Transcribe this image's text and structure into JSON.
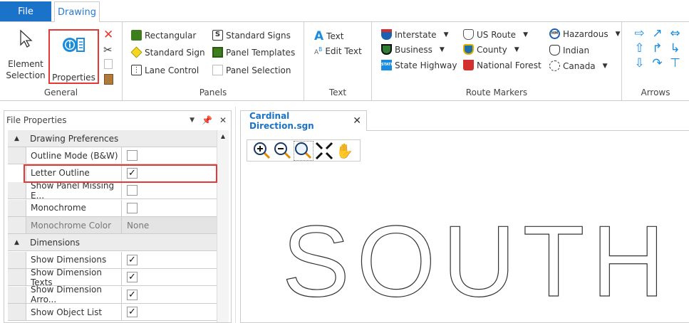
{
  "tabs": {
    "file": "File",
    "drawing": "Drawing"
  },
  "general": {
    "label": "General",
    "element_selection": "Element Selection",
    "properties": "Properties"
  },
  "panels": {
    "label": "Panels",
    "items": [
      "Rectangular",
      "Standard Sign",
      "Lane Control",
      "Standard Signs",
      "Panel Templates",
      "Panel Selection"
    ]
  },
  "text": {
    "label": "Text",
    "text": "Text",
    "edit_text": "Edit Text"
  },
  "route_markers": {
    "label": "Route Markers",
    "items": [
      "Interstate",
      "Business",
      "State Highway",
      "US Route",
      "County",
      "National Forest",
      "Hazardous",
      "Indian",
      "Canada"
    ],
    "state_badge": "STATE",
    "hm_badge": "HM"
  },
  "arrows": {
    "label": "Arrows"
  },
  "file_properties": {
    "title": "File Properties",
    "categories": [
      {
        "name": "Drawing Preferences",
        "rows": [
          {
            "label": "Outline Mode (B&W)",
            "checked": false
          },
          {
            "label": "Letter Outline",
            "checked": true
          },
          {
            "label": "Show Panel Missing E...",
            "checked": false
          },
          {
            "label": "Monochrome",
            "checked": false
          },
          {
            "label": "Monochrome Color",
            "value": "None",
            "disabled": true
          }
        ]
      },
      {
        "name": "Dimensions",
        "rows": [
          {
            "label": "Show Dimensions",
            "checked": true
          },
          {
            "label": "Show Dimension Texts",
            "checked": true
          },
          {
            "label": "Show Dimension Arro...",
            "checked": true
          },
          {
            "label": "Show Object List",
            "checked": true
          }
        ]
      }
    ]
  },
  "document": {
    "tab": "Cardinal Direction.sgn",
    "canvas_text": "SOUTH"
  },
  "colors": {
    "accent": "#1a73c8",
    "highlight": "#e53935"
  }
}
